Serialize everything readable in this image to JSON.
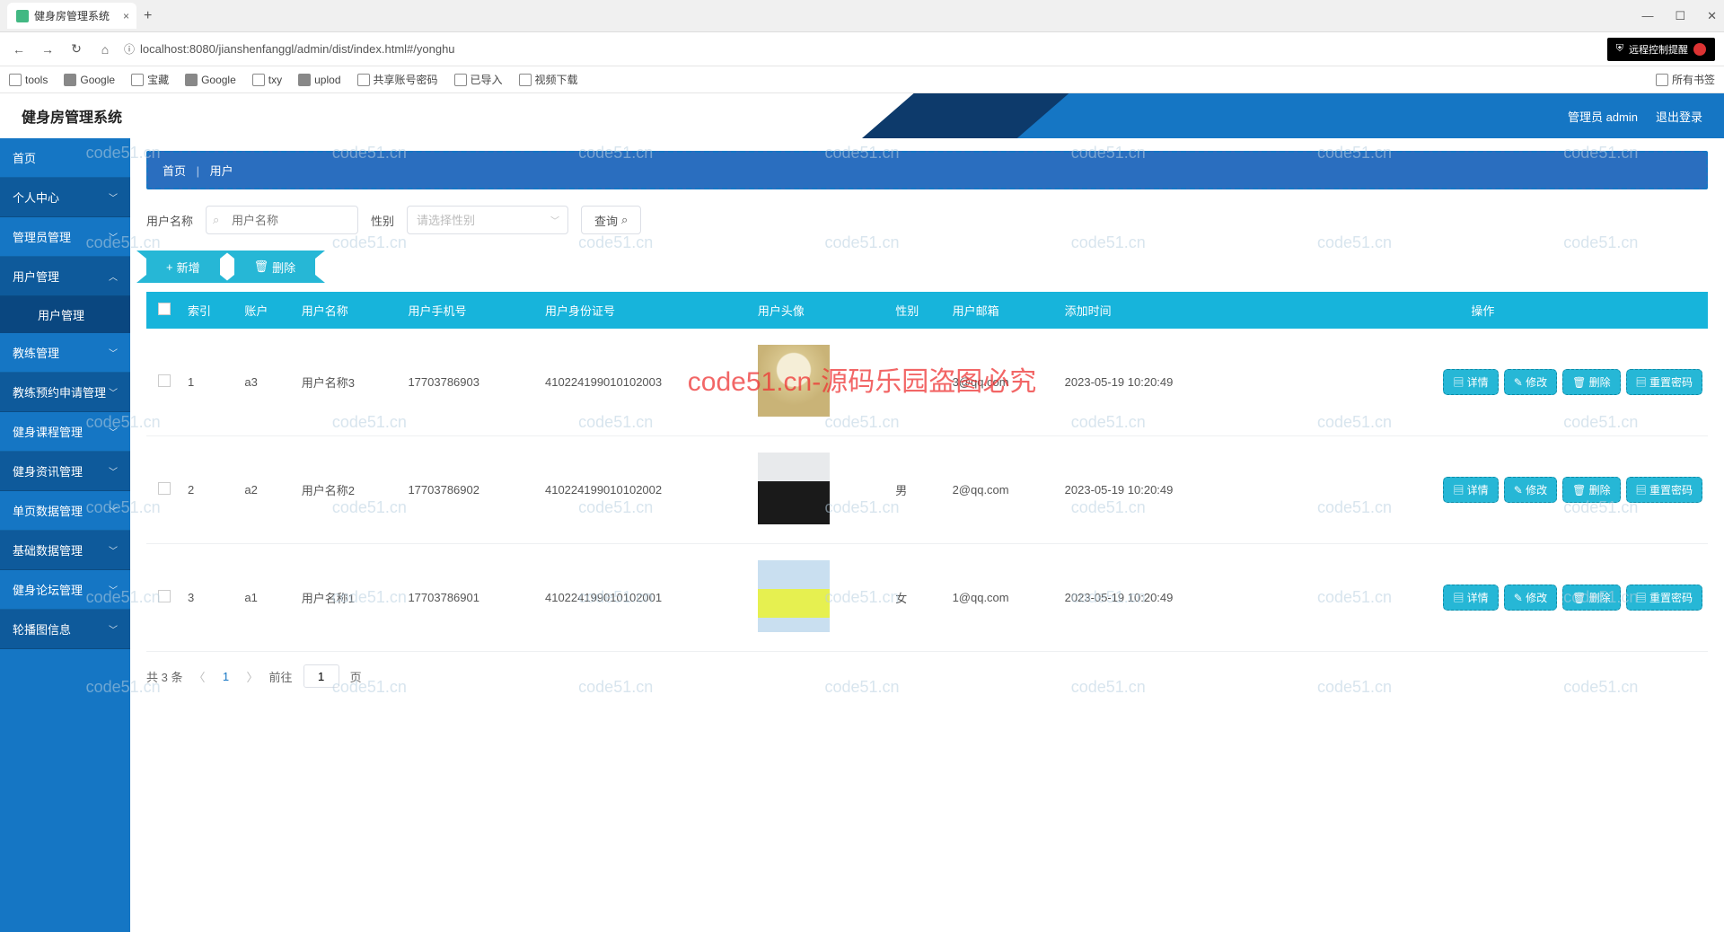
{
  "browser": {
    "tab_title": "健身房管理系统",
    "url": "localhost:8080/jianshenfanggl/admin/dist/index.html#/yonghu",
    "remote_label": "远程控制提醒",
    "bookmarks": [
      "tools",
      "Google",
      "宝藏",
      "Google",
      "txy",
      "uplod",
      "共享账号密码",
      "已导入",
      "视频下载"
    ],
    "all_bookmarks": "所有书签"
  },
  "header": {
    "title": "健身房管理系统",
    "admin_label": "管理员 admin",
    "logout": "退出登录"
  },
  "sidebar": {
    "home": "首页",
    "items": [
      "个人中心",
      "管理员管理",
      "用户管理",
      "教练管理",
      "教练预约申请管理",
      "健身课程管理",
      "健身资讯管理",
      "单页数据管理",
      "基础数据管理",
      "健身论坛管理",
      "轮播图信息"
    ],
    "sub_user": "用户管理"
  },
  "breadcrumb": {
    "home": "首页",
    "current": "用户"
  },
  "filters": {
    "username_label": "用户名称",
    "username_placeholder": "用户名称",
    "gender_label": "性别",
    "gender_placeholder": "请选择性别",
    "search_btn": "查询"
  },
  "actions": {
    "add": "新增",
    "delete": "删除"
  },
  "table": {
    "headers": [
      "索引",
      "账户",
      "用户名称",
      "用户手机号",
      "用户身份证号",
      "用户头像",
      "性别",
      "用户邮箱",
      "添加时间",
      "操作"
    ],
    "rows": [
      {
        "idx": "1",
        "acc": "a3",
        "name": "用户名称3",
        "phone": "17703786903",
        "idcard": "410224199010102003",
        "gender": "",
        "email": "3@qq.com",
        "time": "2023-05-19 10:20:49"
      },
      {
        "idx": "2",
        "acc": "a2",
        "name": "用户名称2",
        "phone": "17703786902",
        "idcard": "410224199010102002",
        "gender": "男",
        "email": "2@qq.com",
        "time": "2023-05-19 10:20:49"
      },
      {
        "idx": "3",
        "acc": "a1",
        "name": "用户名称1",
        "phone": "17703786901",
        "idcard": "410224199010102001",
        "gender": "女",
        "email": "1@qq.com",
        "time": "2023-05-19 10:20:49"
      }
    ],
    "ops": {
      "detail": "详情",
      "edit": "修改",
      "delete": "删除",
      "reset": "重置密码"
    }
  },
  "pager": {
    "total_prefix": "共",
    "total_count": "3",
    "total_suffix": "条",
    "goto": "前往",
    "page_val": "1",
    "page_suffix": "页",
    "current": "1"
  },
  "watermark": "code51.cn",
  "watermark_big": "code51.cn-源码乐园盗图必究"
}
